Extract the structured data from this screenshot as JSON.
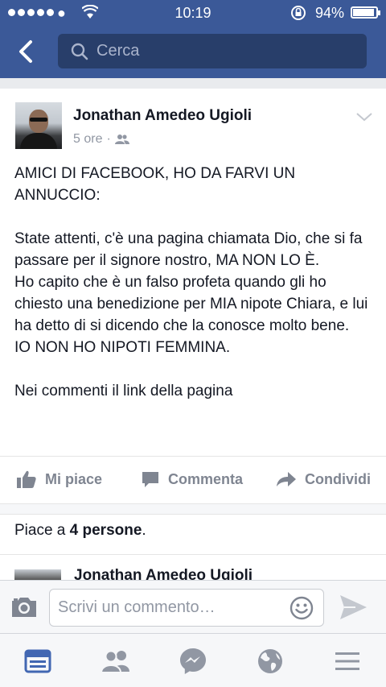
{
  "status_bar": {
    "time": "10:19",
    "battery_text": "94%",
    "battery_level": 0.94,
    "icons": [
      "signal-dots",
      "carrier-icon",
      "wifi-icon",
      "rotation-lock-icon",
      "battery-icon"
    ]
  },
  "nav": {
    "back_icon": "chevron-left-icon",
    "search_placeholder": "Cerca"
  },
  "post": {
    "author": "Jonathan Amedeo Ugioli",
    "time_ago": "5 ore",
    "separator": "·",
    "audience_icon": "friends-icon",
    "paragraphs": [
      "AMICI DI FACEBOOK, HO DA FARVI UN ANNUCCIO:",
      "",
      "State attenti, c'è una pagina chiamata Dio, che si fa passare per il signore nostro, MA NON LO È.",
      "Ho capito che è un falso profeta quando gli ho chiesto una benedizione per MIA nipote Chiara, e lui ha detto di si dicendo che la conosce molto bene.",
      "IO NON HO NIPOTI FEMMINA.",
      "",
      "Nei commenti il link della pagina"
    ]
  },
  "actions": {
    "like": "Mi piace",
    "comment": "Commenta",
    "share": "Condividi"
  },
  "likes": {
    "prefix": "Piace a ",
    "count": "4 persone",
    "suffix": "."
  },
  "first_comment": {
    "author": "Jonathan Amedeo Ugioli"
  },
  "comment_bar": {
    "placeholder": "Scrivi un commento…"
  },
  "tabbar": {
    "tabs": [
      "news-feed-icon",
      "friend-requests-icon",
      "messenger-icon",
      "notifications-globe-icon",
      "more-menu-icon"
    ],
    "active_index": 0
  },
  "colors": {
    "brand": "#3b5998",
    "active_tab": "#4267b2",
    "inactive_icon": "#9197a3"
  }
}
